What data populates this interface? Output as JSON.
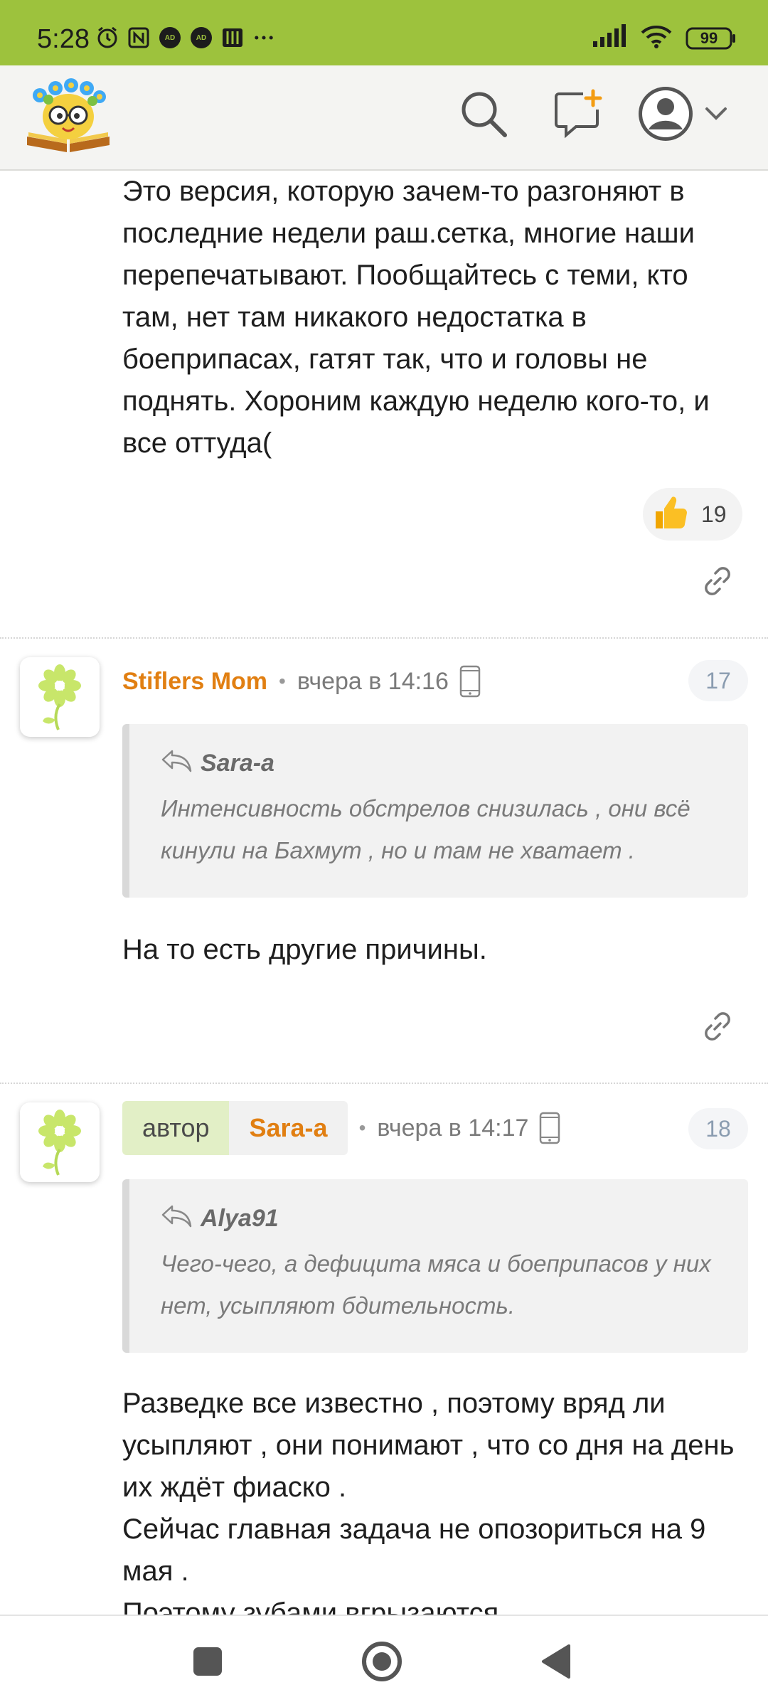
{
  "status_bar": {
    "time": "5:28",
    "notification_icons": [
      "alarm-icon",
      "nfc-icon",
      "adblock-icon",
      "adblock-icon",
      "books-icon",
      "more-dots-icon"
    ],
    "battery": "99",
    "accent": "#9dc23d"
  },
  "header": {
    "logo": "site-logo",
    "actions": [
      "search-icon",
      "new-topic-icon",
      "user-avatar-icon",
      "chevron-down-icon"
    ]
  },
  "post_top": {
    "text": "Это версия, которую зачем-то разгоняют в последние недели раш.сетка, многие наши перепечатывают. Пообщайтесь с теми, кто там, нет там никакого недостатка в боеприпасах, гатят так, что и головы не поднять. Хороним каждую неделю кого-то, и все оттуда(",
    "likes": "19"
  },
  "comment_17": {
    "username": "Stiflers Mom",
    "time": "вчера в 14:16",
    "number": "17",
    "quote_author": "Sara-a",
    "quote_text": "Интенсивность обстрелов снизилась , они всё кинули на Бахмут , но и там не хватает .",
    "text": "На то есть другие причины."
  },
  "comment_18": {
    "author_label": "автор",
    "username": "Sara-a",
    "time": "вчера в 14:17",
    "number": "18",
    "quote_author": "Alya91",
    "quote_text": "Чего-чего, а дефицита мяса и боеприпасов у них нет, усыпляют бдительность.",
    "text_lines": [
      "Разведке все известно , поэтому вряд ли усыпляют , они понимают , что со дня на день их ждёт фиаско .",
      "Сейчас главная задача не опозориться на 9 мая .",
      "Поэтому зубами вгрызаются ."
    ]
  },
  "colors": {
    "username": "#e17f12",
    "author_tag_bg": "#e2efc6",
    "quote_bg": "#f2f2f2"
  },
  "nav_bar": {
    "buttons": [
      "recents-button",
      "home-button",
      "back-button"
    ]
  }
}
